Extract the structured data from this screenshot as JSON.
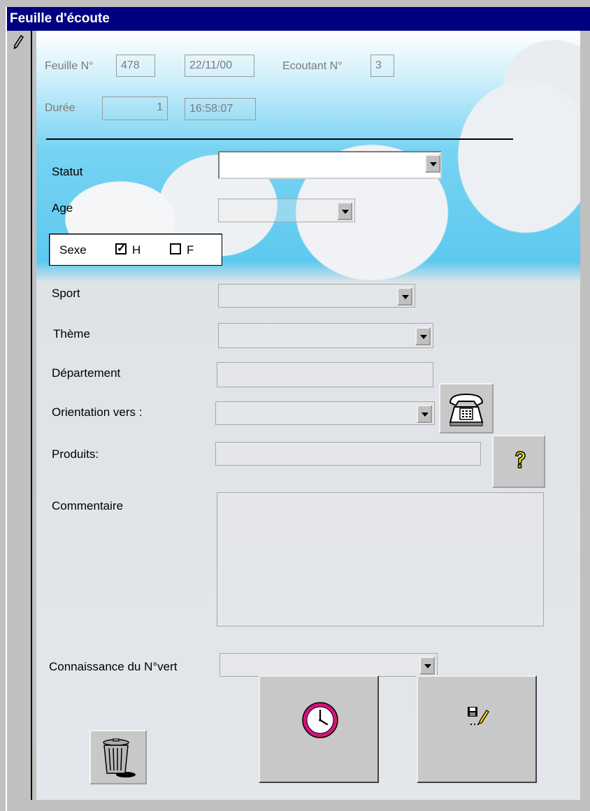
{
  "window": {
    "title": "Feuille d'écoute"
  },
  "header": {
    "feuille_label": "Feuille N°",
    "feuille_value": "478",
    "date_value": "22/11/00",
    "ecoutant_label": "Ecoutant N°",
    "ecoutant_value": "3",
    "duree_label": "Durée",
    "duree_value": "1",
    "time_value": "16:58:07"
  },
  "form": {
    "statut_label": "Statut",
    "statut_value": "",
    "age_label": "Age",
    "age_value": "",
    "sexe_label": "Sexe",
    "sexe_h_label": "H",
    "sexe_h_checked": true,
    "sexe_h_mark": "✓",
    "sexe_f_label": "F",
    "sexe_f_checked": false,
    "sport_label": "Sport",
    "theme_label": "Thème",
    "departement_label": "Département",
    "orientation_label": "Orientation vers :",
    "produits_label": "Produits:",
    "commentaire_label": "Commentaire",
    "connaissance_label": "Connaissance du N°vert"
  },
  "icons": {
    "record_selector": "pencil-icon",
    "phone": "telephone-icon",
    "help": "question-mark-icon",
    "delete": "trash-can-icon",
    "clock": "clock-icon",
    "save": "floppy-disk-edit-icon"
  },
  "colors": {
    "title_bar": "#000080",
    "sky": "#5dc9ef",
    "window": "#c0c0c0"
  }
}
